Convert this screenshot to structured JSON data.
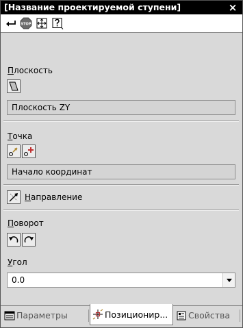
{
  "window": {
    "title": "[Название проектируемой ступени]",
    "close_glyph": "×"
  },
  "toolbar": {
    "icons": [
      "enter-arrow-icon",
      "stop-icon",
      "expand-icon",
      "help-icon"
    ]
  },
  "plane": {
    "label_first": "П",
    "label_rest": "лоскость",
    "value": "Плоскость ZY"
  },
  "point": {
    "label_first": "Т",
    "label_rest": "очка",
    "value": "Начало координат"
  },
  "direction": {
    "label_first": "Н",
    "label_rest": "аправление"
  },
  "rotation": {
    "label_first": "П",
    "label_rest": "оворот"
  },
  "angle": {
    "label_first": "У",
    "label_rest": "гол",
    "value": "0.0"
  },
  "tabs": [
    {
      "label": "Параметры",
      "active": false
    },
    {
      "label": "Позиционир...",
      "active": true
    },
    {
      "label": "Свойства",
      "active": false
    }
  ]
}
